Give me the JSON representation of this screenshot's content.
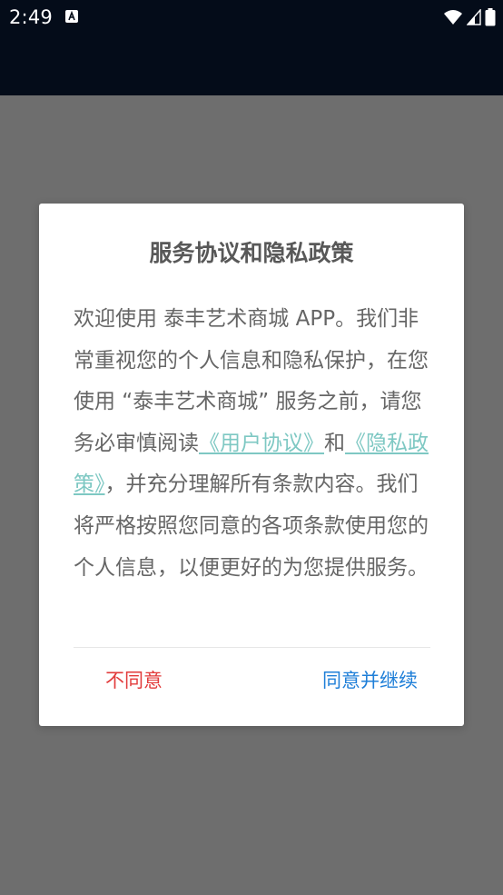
{
  "status_bar": {
    "time": "2:49",
    "notification_icon": "a-letter-icon",
    "icons": [
      "wifi-icon",
      "signal-icon",
      "battery-icon"
    ]
  },
  "dialog": {
    "title": "服务协议和隐私政策",
    "body": {
      "part1": "欢迎使用 泰丰艺术商城 APP。我们非常重视您的个人信息和隐私保护，在您使用 “泰丰艺术商城” 服务之前，请您务必审慎阅读",
      "user_agreement_link": "《用户协议》",
      "part2": "和",
      "privacy_policy_link": "《隐私政策》",
      "part3": "，并充分理解所有条款内容。我们将严格按照您同意的各项条款使用您的个人信息，以便更好的为您提供服务。"
    },
    "buttons": {
      "disagree": "不同意",
      "agree": "同意并继续"
    }
  },
  "colors": {
    "status_bar_bg": "#040c19",
    "overlay": "#6e6e6e",
    "link": "#7ec8c3",
    "disagree": "#e23b3b",
    "agree": "#1f7fd8"
  }
}
